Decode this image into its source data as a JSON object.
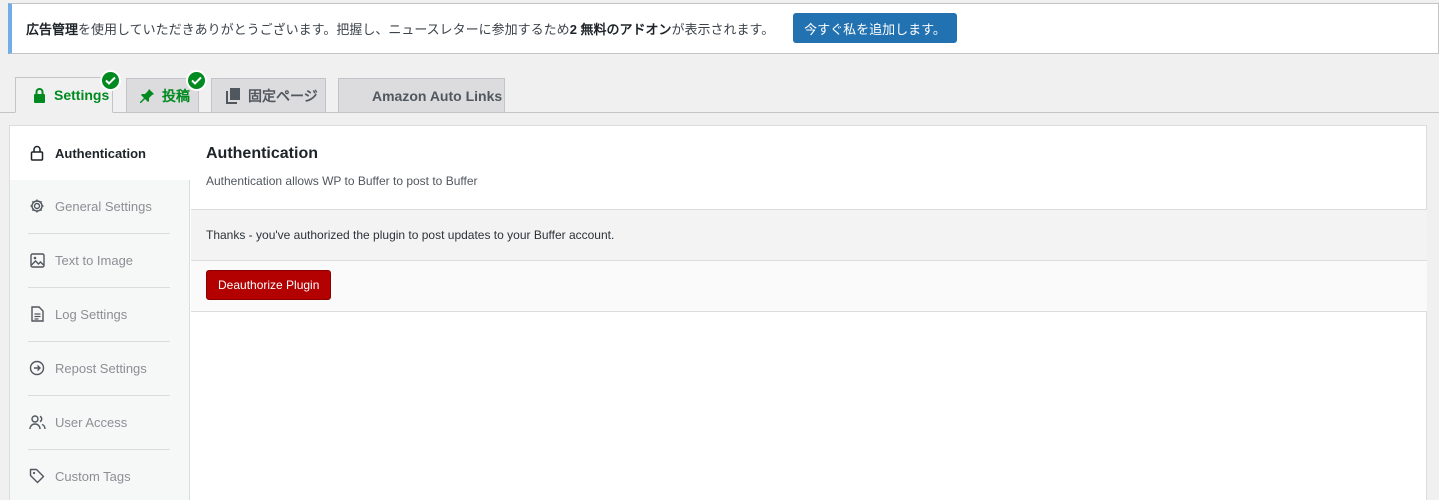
{
  "notice": {
    "bold_prefix": "広告管理",
    "text_1": "を使用していただきありがとうございます。把握し、ニュースレターに参加するため",
    "bold_mid": "2 無料のアドオン",
    "text_2": "が表示されます。",
    "button_label": "今すぐ私を追加します。",
    "accent_color": "#72aee6"
  },
  "tabs": [
    {
      "label": "Settings",
      "icon": "lock-icon",
      "checked": true,
      "active": true
    },
    {
      "label": "投稿",
      "icon": "pin-icon",
      "checked": true,
      "active": false
    },
    {
      "label": "固定ページ",
      "icon": "pages-icon",
      "checked": false,
      "active": false
    },
    {
      "label": "Amazon Auto Links",
      "icon": "",
      "checked": false,
      "active": false
    }
  ],
  "sidebar": {
    "items": [
      {
        "label": "Authentication",
        "icon": "lock-icon",
        "active": true
      },
      {
        "label": "General Settings",
        "icon": "gear-icon",
        "active": false
      },
      {
        "label": "Text to Image",
        "icon": "image-icon",
        "active": false
      },
      {
        "label": "Log Settings",
        "icon": "document-icon",
        "active": false
      },
      {
        "label": "Repost Settings",
        "icon": "arrow-circle-icon",
        "active": false
      },
      {
        "label": "User Access",
        "icon": "users-icon",
        "active": false
      },
      {
        "label": "Custom Tags",
        "icon": "tag-icon",
        "active": false
      }
    ]
  },
  "main": {
    "title": "Authentication",
    "description": "Authentication allows WP to Buffer to post to Buffer",
    "message": "Thanks - you've authorized the plugin to post updates to your Buffer account.",
    "deauthorize_label": "Deauthorize Plugin"
  },
  "colors": {
    "primary": "#2271b1",
    "success": "#008a20",
    "danger": "#b30000"
  }
}
